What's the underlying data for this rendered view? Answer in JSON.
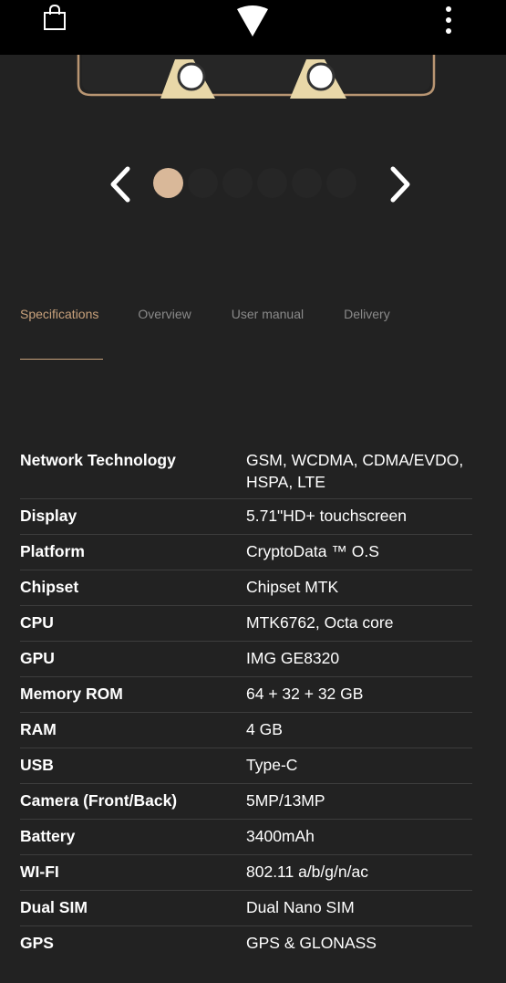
{
  "header": {
    "cart_icon": "shopping-bag-icon",
    "logo_icon": "brand-triangle-logo",
    "menu_icon": "kebab-menu-icon"
  },
  "carousel": {
    "prev_icon": "chevron-left-icon",
    "next_icon": "chevron-right-icon",
    "dot_count": 6,
    "active_index": 0,
    "accent": "#d9b899"
  },
  "tabs": [
    {
      "label": "Specifications",
      "active": true
    },
    {
      "label": "Overview",
      "active": false
    },
    {
      "label": "User manual",
      "active": false
    },
    {
      "label": "Delivery",
      "active": false
    }
  ],
  "specs": [
    {
      "label": "Network Technology",
      "value": "GSM, WCDMA, CDMA/EVDO, HSPA, LTE"
    },
    {
      "label": "Display",
      "value": "5.71\"HD+ touchscreen"
    },
    {
      "label": "Platform",
      "value": "CryptoData ™ O.S"
    },
    {
      "label": "Chipset",
      "value": "Chipset MTK"
    },
    {
      "label": "CPU",
      "value": "MTK6762, Octa core"
    },
    {
      "label": "GPU",
      "value": "IMG GE8320"
    },
    {
      "label": "Memory ROM",
      "value": "64 + 32 + 32 GB"
    },
    {
      "label": "RAM",
      "value": "4 GB"
    },
    {
      "label": "USB",
      "value": "Type-C"
    },
    {
      "label": "Camera (Front/Back)",
      "value": "5MP/13MP"
    },
    {
      "label": "Battery",
      "value": "3400mAh"
    },
    {
      "label": "WI-FI",
      "value": "802.11 a/b/g/n/ac"
    },
    {
      "label": "Dual SIM",
      "value": "Dual Nano SIM"
    },
    {
      "label": "GPS",
      "value": "GPS & GLONASS"
    }
  ],
  "colors": {
    "background": "#222222",
    "header": "#000000",
    "accent": "#c9a27c",
    "tab_inactive": "#8a8a8a",
    "divider": "#3d3d3d"
  }
}
